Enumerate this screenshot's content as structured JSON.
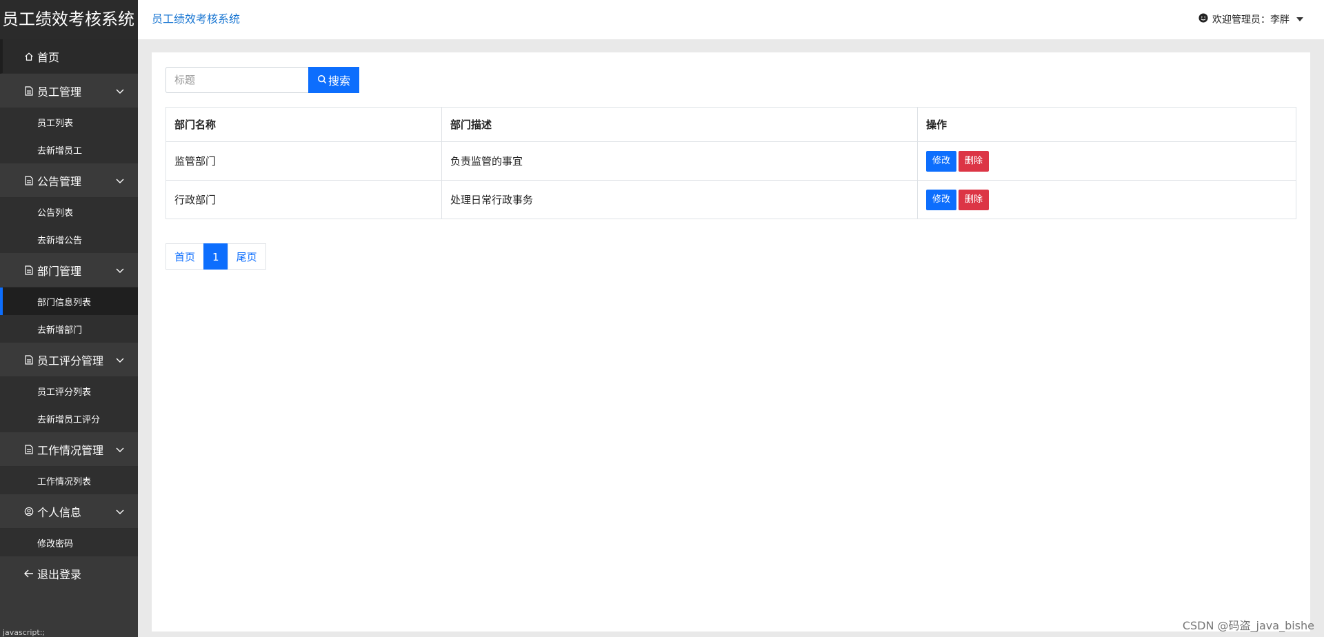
{
  "brand": "员工绩效考核系统",
  "sidebar": {
    "home": "首页",
    "groups": [
      {
        "label": "员工管理",
        "items": [
          "员工列表",
          "去新增员工"
        ]
      },
      {
        "label": "公告管理",
        "items": [
          "公告列表",
          "去新增公告"
        ]
      },
      {
        "label": "部门管理",
        "items": [
          "部门信息列表",
          "去新增部门"
        ]
      },
      {
        "label": "员工评分管理",
        "items": [
          "员工评分列表",
          "去新增员工评分"
        ]
      },
      {
        "label": "工作情况管理",
        "items": [
          "工作情况列表"
        ]
      },
      {
        "label": "个人信息",
        "items": [
          "修改密码"
        ]
      }
    ],
    "logout": "退出登录",
    "active_item": "部门信息列表",
    "bottom_text": "javascript:;"
  },
  "header": {
    "title": "员工绩效考核系统",
    "welcome": "欢迎管理员：李胖"
  },
  "search": {
    "placeholder": "标题",
    "button_label": "搜索"
  },
  "table": {
    "headers": [
      "部门名称",
      "部门描述",
      "操作"
    ],
    "rows": [
      {
        "name": "监管部门",
        "desc": "负责监管的事宜"
      },
      {
        "name": "行政部门",
        "desc": "处理日常行政事务"
      }
    ],
    "edit_label": "修改",
    "delete_label": "删除"
  },
  "pagination": {
    "first": "首页",
    "current": "1",
    "last": "尾页"
  },
  "watermark": "CSDN @码盗_java_bishe",
  "colors": {
    "sidebar_bg": "#393939",
    "primary": "#0d6efd",
    "danger": "#dc3545",
    "header_link": "#1976d2"
  }
}
